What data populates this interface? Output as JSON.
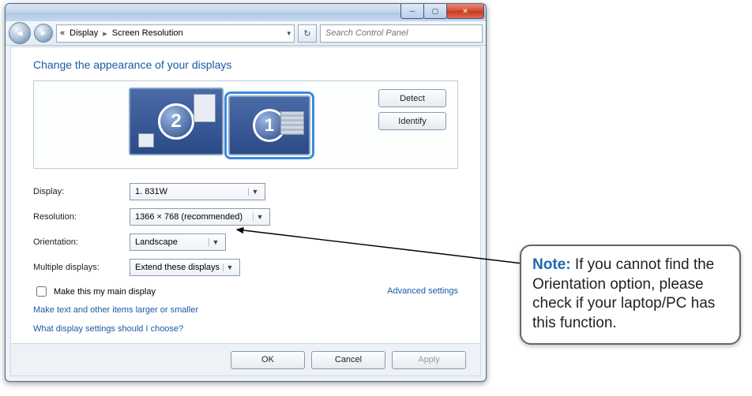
{
  "breadcrumb": {
    "root": "«",
    "p1": "Display",
    "p2": "Screen Resolution"
  },
  "search": {
    "placeholder": "Search Control Panel"
  },
  "heading": "Change the appearance of your displays",
  "preview": {
    "monitors": [
      {
        "number": "2",
        "selected": false
      },
      {
        "number": "1",
        "selected": true
      }
    ],
    "detect": "Detect",
    "identify": "Identify"
  },
  "fields": {
    "display_label": "Display:",
    "display_value": "1. 831W",
    "resolution_label": "Resolution:",
    "resolution_value": "1366 × 768 (recommended)",
    "orientation_label": "Orientation:",
    "orientation_value": "Landscape",
    "multi_label": "Multiple displays:",
    "multi_value": "Extend these displays"
  },
  "checkbox_label": "Make this my main display",
  "advanced_link": "Advanced settings",
  "link1": "Make text and other items larger or smaller",
  "link2": "What display settings should I choose?",
  "buttons": {
    "ok": "OK",
    "cancel": "Cancel",
    "apply": "Apply"
  },
  "note": {
    "prefix": "Note:",
    "body": " If you cannot find the Orientation option, please check if your laptop/PC has this function."
  }
}
